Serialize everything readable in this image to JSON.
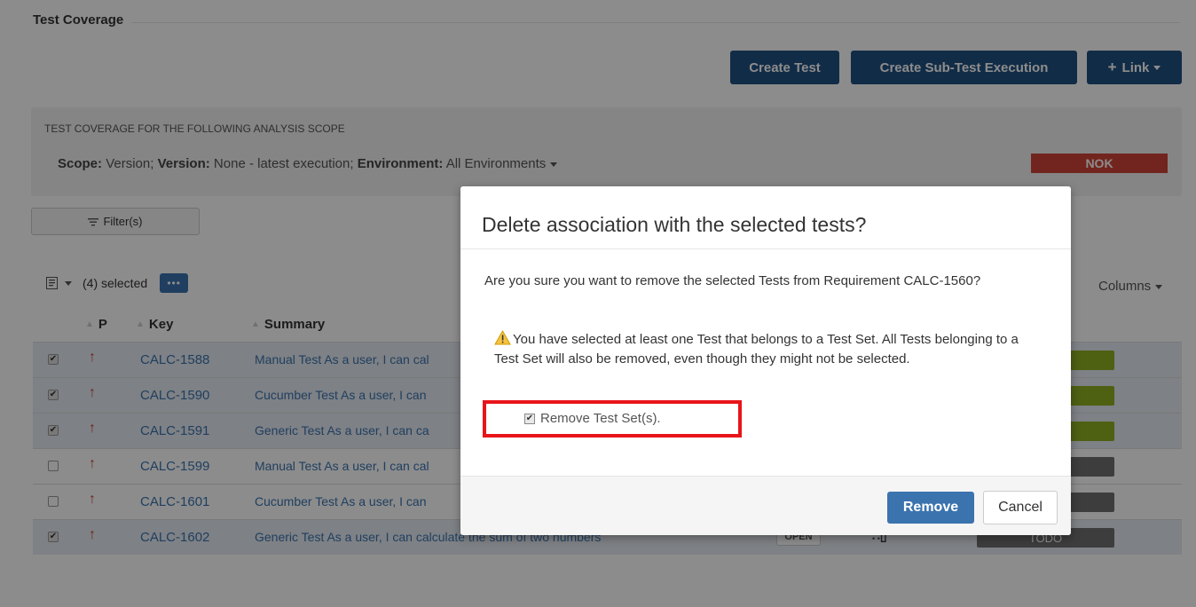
{
  "section": {
    "title": "Test Coverage"
  },
  "actions": {
    "create_test": "Create Test",
    "create_sub": "Create Sub-Test Execution",
    "link": "Link"
  },
  "scope": {
    "heading": "TEST COVERAGE FOR THE FOLLOWING ANALYSIS SCOPE",
    "scope_label": "Scope:",
    "scope_value": "Version;",
    "version_label": "Version:",
    "version_value": "None - latest execution;",
    "env_label": "Environment:",
    "env_value": "All Environments",
    "status": "NOK"
  },
  "filter": {
    "label": "Filter(s)"
  },
  "toolbar": {
    "selected": "(4) selected",
    "columns": "Columns"
  },
  "table": {
    "headers": {
      "p": "P",
      "key": "Key",
      "summary": "Summary"
    },
    "rows": [
      {
        "selected": true,
        "key": "CALC-1588",
        "summary": "Manual Test As a user, I can cal",
        "status": "",
        "progress_color": "#8eb021",
        "progress_label": ""
      },
      {
        "selected": true,
        "key": "CALC-1590",
        "summary": "Cucumber Test As a user, I can",
        "status": "",
        "progress_color": "#8eb021",
        "progress_label": ""
      },
      {
        "selected": true,
        "key": "CALC-1591",
        "summary": "Generic Test As a user, I can ca",
        "status": "",
        "progress_color": "#8eb021",
        "progress_label": ""
      },
      {
        "selected": false,
        "key": "CALC-1599",
        "summary": "Manual Test As a user, I can cal",
        "status": "",
        "progress_color": "#707070",
        "progress_label": ""
      },
      {
        "selected": false,
        "key": "CALC-1601",
        "summary": "Cucumber Test As a user, I can",
        "status": "",
        "progress_color": "#707070",
        "progress_label": ""
      },
      {
        "selected": true,
        "key": "CALC-1602",
        "summary": "Generic Test As a user, I can calculate the sum of two numbers",
        "status": "OPEN",
        "progress_color": "#707070",
        "progress_label": "TODO"
      }
    ]
  },
  "modal": {
    "title": "Delete association with the selected tests?",
    "message": "Are you sure you want to remove the selected Tests from Requirement CALC-1560?",
    "warning": "You have selected at least one Test that belongs to a Test Set. All Tests belonging to a Test Set will also be removed, even though they might not be selected.",
    "checkbox_label": "Remove Test Set(s).",
    "remove": "Remove",
    "cancel": "Cancel"
  },
  "colors": {
    "primary": "#3b73af",
    "dark_primary": "#205081",
    "nok": "#d04437",
    "pass": "#8eb021",
    "todo": "#707070",
    "highlight": "#e8141a"
  }
}
